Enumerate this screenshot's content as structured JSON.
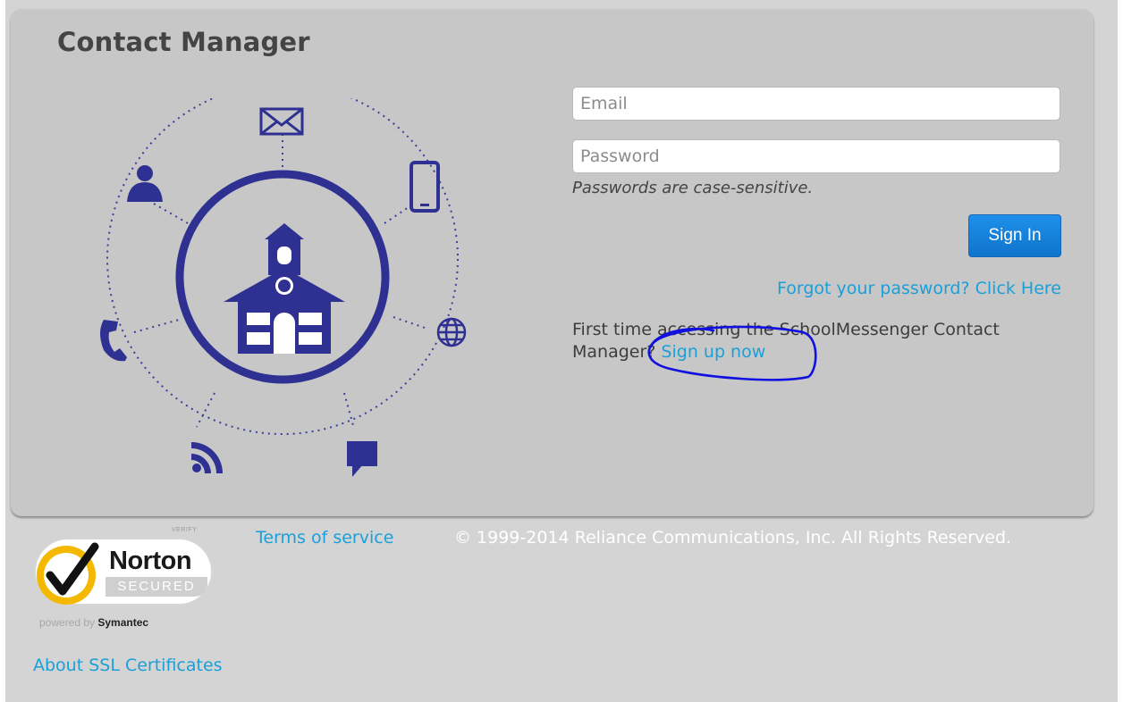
{
  "app": {
    "title": "Contact Manager"
  },
  "login": {
    "email_placeholder": "Email",
    "password_placeholder": "Password",
    "password_hint": "Passwords are case-sensitive.",
    "signin_label": "Sign In",
    "forgot_link": "Forgot your password? Click Here",
    "first_time_text": "First time accessing the SchoolMessenger Contact Manager? ",
    "signup_link": "Sign up now"
  },
  "footer": {
    "terms_link": "Terms of service",
    "copyright": "© 1999-2014 Reliance Communications, Inc. All Rights Reserved.",
    "ssl_link": "About SSL Certificates"
  },
  "norton": {
    "verify": "VERIFY",
    "name": "Norton",
    "secured": "SECURED",
    "powered_prefix": "powered by ",
    "powered_brand": "Symantec"
  },
  "illustration": {
    "icons": [
      "envelope-icon",
      "mobile-phone-icon",
      "globe-icon",
      "chat-bubble-icon",
      "rss-icon",
      "telephone-icon",
      "person-icon",
      "schoolhouse-icon"
    ]
  },
  "colors": {
    "accent": "#1a9fd9",
    "button": "#1379d4",
    "illustration": "#2e3192",
    "card": "#c7c7c7",
    "annotation": "#1010e0"
  }
}
